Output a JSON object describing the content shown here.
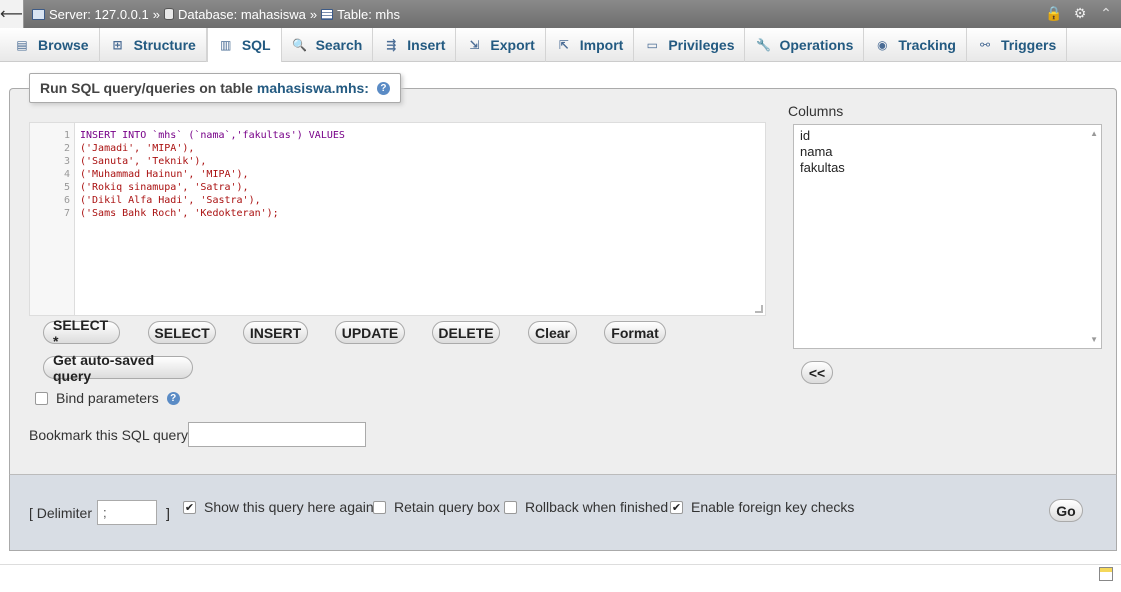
{
  "topbar": {
    "server": "Server: 127.0.0.1",
    "database": "Database: mahasiswa",
    "table": "Table: mhs",
    "sep": "»"
  },
  "tabs": [
    {
      "label": "Browse",
      "icon": "browse-icon"
    },
    {
      "label": "Structure",
      "icon": "structure-icon"
    },
    {
      "label": "SQL",
      "icon": "sql-icon"
    },
    {
      "label": "Search",
      "icon": "search-icon"
    },
    {
      "label": "Insert",
      "icon": "insert-icon"
    },
    {
      "label": "Export",
      "icon": "export-icon"
    },
    {
      "label": "Import",
      "icon": "import-icon"
    },
    {
      "label": "Privileges",
      "icon": "privileges-icon"
    },
    {
      "label": "Operations",
      "icon": "operations-icon"
    },
    {
      "label": "Tracking",
      "icon": "tracking-icon"
    },
    {
      "label": "Triggers",
      "icon": "triggers-icon"
    }
  ],
  "legend": {
    "prefix": "Run SQL query/queries on table",
    "table": "mahasiswa.mhs:"
  },
  "editor": {
    "line_numbers": [
      "1",
      "2",
      "3",
      "4",
      "5",
      "6",
      "7"
    ],
    "lines": [
      "INSERT INTO `mhs` (`nama`,'fakultas') VALUES",
      "('Jamadi', 'MIPA'),",
      "('Sanuta', 'Teknik'),",
      "('Muhammad Hainun', 'MIPA'),",
      "('Rokiq sinamupa', 'Satra'),",
      "('Dikil Alfa Hadi', 'Sastra'),",
      "('Sams Bahk Roch', 'Kedokteran');"
    ]
  },
  "buttons": {
    "select_star": "SELECT *",
    "select": "SELECT",
    "insert": "INSERT",
    "update": "UPDATE",
    "delete": "DELETE",
    "clear": "Clear",
    "format": "Format",
    "autosaved": "Get auto-saved query",
    "insert_columns": "<<",
    "go": "Go"
  },
  "columns": {
    "label": "Columns",
    "items": [
      "id",
      "nama",
      "fakultas"
    ]
  },
  "bind_parameters": {
    "label": "Bind parameters",
    "checked": false
  },
  "bookmark": {
    "label": "Bookmark this SQL query:",
    "value": ""
  },
  "options": {
    "delimiter_label": "[ Delimiter",
    "delimiter_value": ";",
    "delimiter_close": "]",
    "show_again": {
      "label": "Show this query here again",
      "checked": true
    },
    "retain_box": {
      "label": "Retain query box",
      "checked": false
    },
    "rollback": {
      "label": "Rollback when finished",
      "checked": false
    },
    "foreign_keys": {
      "label": "Enable foreign key checks",
      "checked": true
    }
  }
}
